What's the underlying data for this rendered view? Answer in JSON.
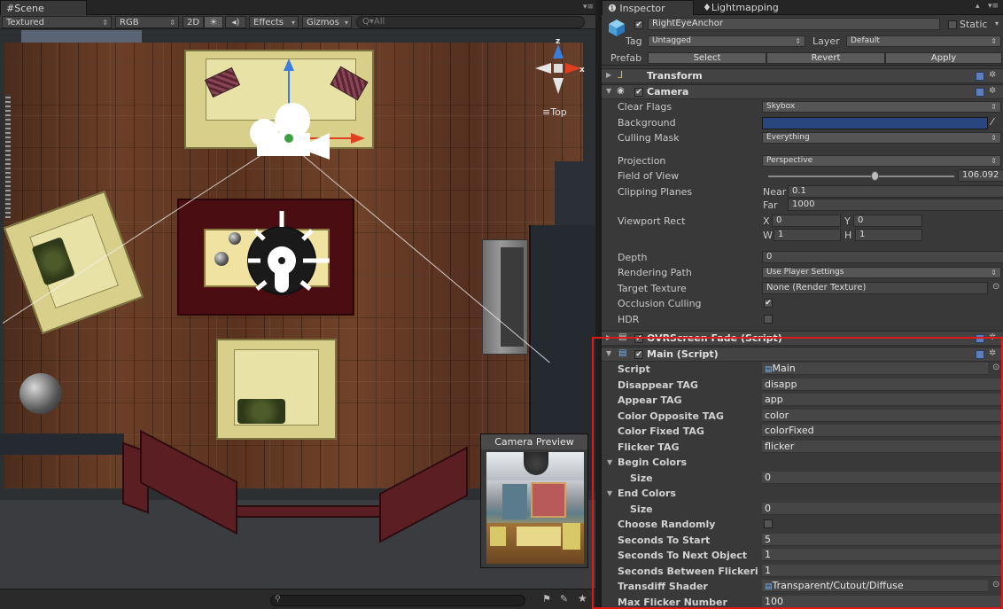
{
  "scene": {
    "tab_label": "Scene",
    "toolbar": {
      "render_mode": "Textured",
      "color_mode": "RGB",
      "btn_2d": "2D",
      "btn_light": "☀",
      "btn_audio": "◂)",
      "effects": "Effects",
      "gizmos": "Gizmos",
      "search_placeholder": "Q▾All"
    },
    "gizmo": {
      "axis_z": "z",
      "axis_x": "x",
      "view_label": "≡Top"
    },
    "camera_preview": {
      "title": "Camera Preview"
    }
  },
  "inspector": {
    "tabs": [
      {
        "label": "Inspector",
        "icon": "info-icon"
      },
      {
        "label": "Lightmapping",
        "icon": "bulb-icon"
      }
    ],
    "object": {
      "name": "RightEyeAnchor",
      "static_label": "Static",
      "tag_label": "Tag",
      "tag_value": "Untagged",
      "layer_label": "Layer",
      "layer_value": "Default",
      "prefab_label": "Prefab",
      "prefab_select": "Select",
      "prefab_revert": "Revert",
      "prefab_apply": "Apply"
    },
    "transform": {
      "title": "Transform"
    },
    "camera": {
      "title": "Camera",
      "clear_flags_label": "Clear Flags",
      "clear_flags_value": "Skybox",
      "background_label": "Background",
      "culling_mask_label": "Culling Mask",
      "culling_mask_value": "Everything",
      "projection_label": "Projection",
      "projection_value": "Perspective",
      "fov_label": "Field of View",
      "fov_value": "106.092",
      "clipping_label": "Clipping Planes",
      "near_label": "Near",
      "near_value": "0.1",
      "far_label": "Far",
      "far_value": "1000",
      "viewport_label": "Viewport Rect",
      "vp_x_label": "X",
      "vp_x": "0",
      "vp_y_label": "Y",
      "vp_y": "0",
      "vp_w_label": "W",
      "vp_w": "1",
      "vp_h_label": "H",
      "vp_h": "1",
      "depth_label": "Depth",
      "depth_value": "0",
      "rendering_path_label": "Rendering Path",
      "rendering_path_value": "Use Player Settings",
      "target_texture_label": "Target Texture",
      "target_texture_value": "None (Render Texture)",
      "occlusion_label": "Occlusion Culling",
      "hdr_label": "HDR"
    },
    "ovr_fade": {
      "title": "OVRScreen Fade (Script)"
    },
    "main_script": {
      "title": "Main (Script)",
      "script_label": "Script",
      "script_value": "Main",
      "disappear_tag_label": "Disappear TAG",
      "disappear_tag_value": "disapp",
      "appear_tag_label": "Appear TAG",
      "appear_tag_value": "app",
      "color_opposite_label": "Color Opposite TAG",
      "color_opposite_value": "color",
      "color_fixed_label": "Color Fixed TAG",
      "color_fixed_value": "colorFixed",
      "flicker_tag_label": "Flicker TAG",
      "flicker_tag_value": "flicker",
      "begin_colors_label": "Begin Colors",
      "begin_size_label": "Size",
      "begin_size_value": "0",
      "end_colors_label": "End Colors",
      "end_size_label": "Size",
      "end_size_value": "0",
      "choose_randomly_label": "Choose Randomly",
      "seconds_to_start_label": "Seconds To Start",
      "seconds_to_start_value": "5",
      "seconds_next_object_label": "Seconds To Next Object",
      "seconds_next_object_value": "1",
      "seconds_between_label": "Seconds Between Flickeri",
      "seconds_between_value": "1",
      "transdiff_label": "Transdiff Shader",
      "transdiff_value": "Transparent/Cutout/Diffuse",
      "max_flicker_label": "Max Flicker Number",
      "max_flicker_value": "100"
    }
  },
  "colors": {
    "highlight_box": "#e01818",
    "background_swatch": "#29467e"
  }
}
